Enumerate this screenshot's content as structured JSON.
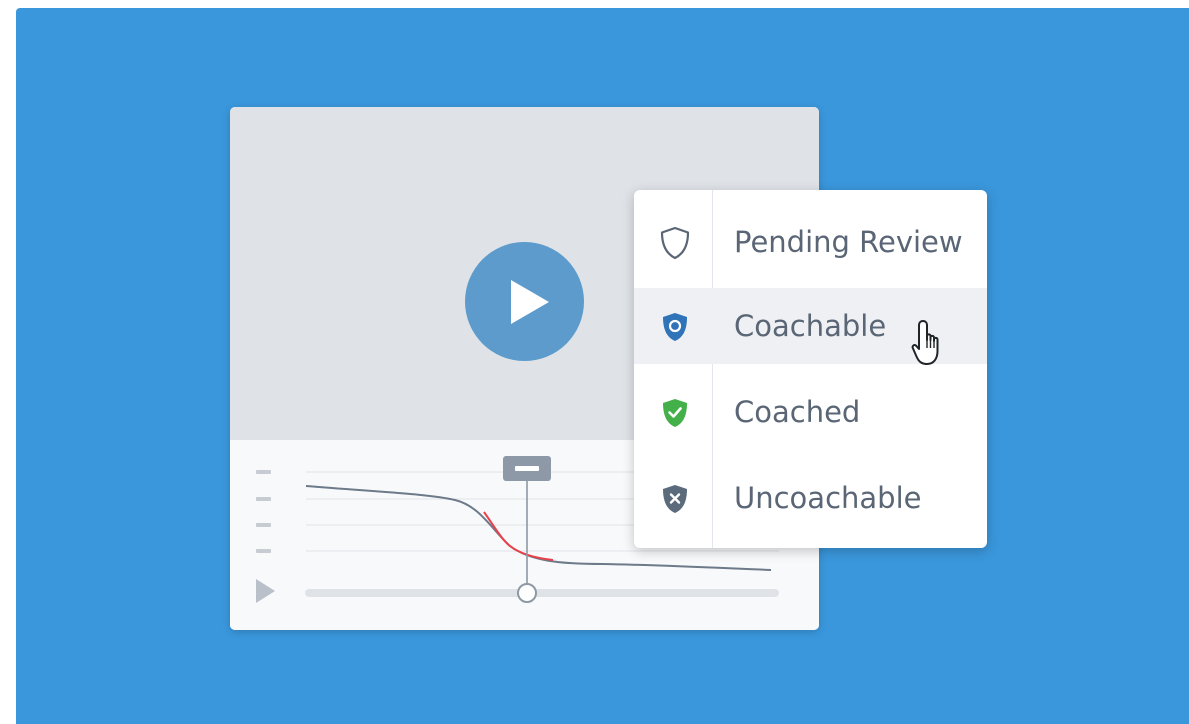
{
  "menu": {
    "items": [
      {
        "label": "Pending Review",
        "icon": "shield-outline-icon",
        "color": "#5a6675",
        "hovered": false
      },
      {
        "label": "Coachable",
        "icon": "shield-circle-icon",
        "color": "#2f73b8",
        "hovered": true
      },
      {
        "label": "Coached",
        "icon": "shield-check-icon",
        "color": "#43b049",
        "hovered": false
      },
      {
        "label": "Uncoachable",
        "icon": "shield-x-icon",
        "color": "#5b6b7c",
        "hovered": false
      }
    ]
  },
  "player": {
    "play_icon": "play-icon",
    "small_play_icon": "play-icon",
    "scrubber_progress": 0.41
  },
  "colors": {
    "background": "#3a97dc",
    "play_button": "#5c9bcb",
    "highlight_segment": "#e8414a"
  }
}
